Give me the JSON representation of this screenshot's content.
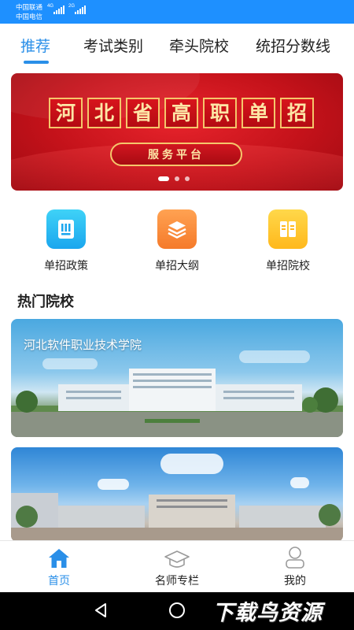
{
  "status_bar": {
    "carrier_1": "中国联通",
    "carrier_2": "中国电信",
    "net_1": "4G",
    "net_2": "2G"
  },
  "tabs": [
    {
      "label": "推荐",
      "active": true
    },
    {
      "label": "考试类别",
      "active": false
    },
    {
      "label": "牵头院校",
      "active": false
    },
    {
      "label": "统招分数线",
      "active": false
    }
  ],
  "banner": {
    "title_chars": [
      "河",
      "北",
      "省",
      "高",
      "职",
      "单",
      "招"
    ],
    "subtitle": "服务平台",
    "slide_count": 3,
    "active_slide": 1
  },
  "quick_links": [
    {
      "label": "单招政策",
      "icon": "document-icon",
      "color": "#1aa6ee"
    },
    {
      "label": "单招大纲",
      "icon": "layers-icon",
      "color": "#f57a2a"
    },
    {
      "label": "单招院校",
      "icon": "book-icon",
      "color": "#ffb81c"
    }
  ],
  "section": {
    "title": "热门院校"
  },
  "schools": [
    {
      "name": "河北软件职业技术学院"
    },
    {
      "name": ""
    }
  ],
  "bottom_nav": [
    {
      "label": "首页",
      "icon": "home-icon",
      "active": true
    },
    {
      "label": "名师专栏",
      "icon": "graduation-cap-icon",
      "active": false
    },
    {
      "label": "我的",
      "icon": "user-icon",
      "active": false
    }
  ],
  "watermark": "下载鸟资源",
  "colors": {
    "accent": "#2a8fe8",
    "status_bar": "#1e90ff",
    "banner_red": "#c4121a",
    "banner_gold": "#f5c66b"
  }
}
